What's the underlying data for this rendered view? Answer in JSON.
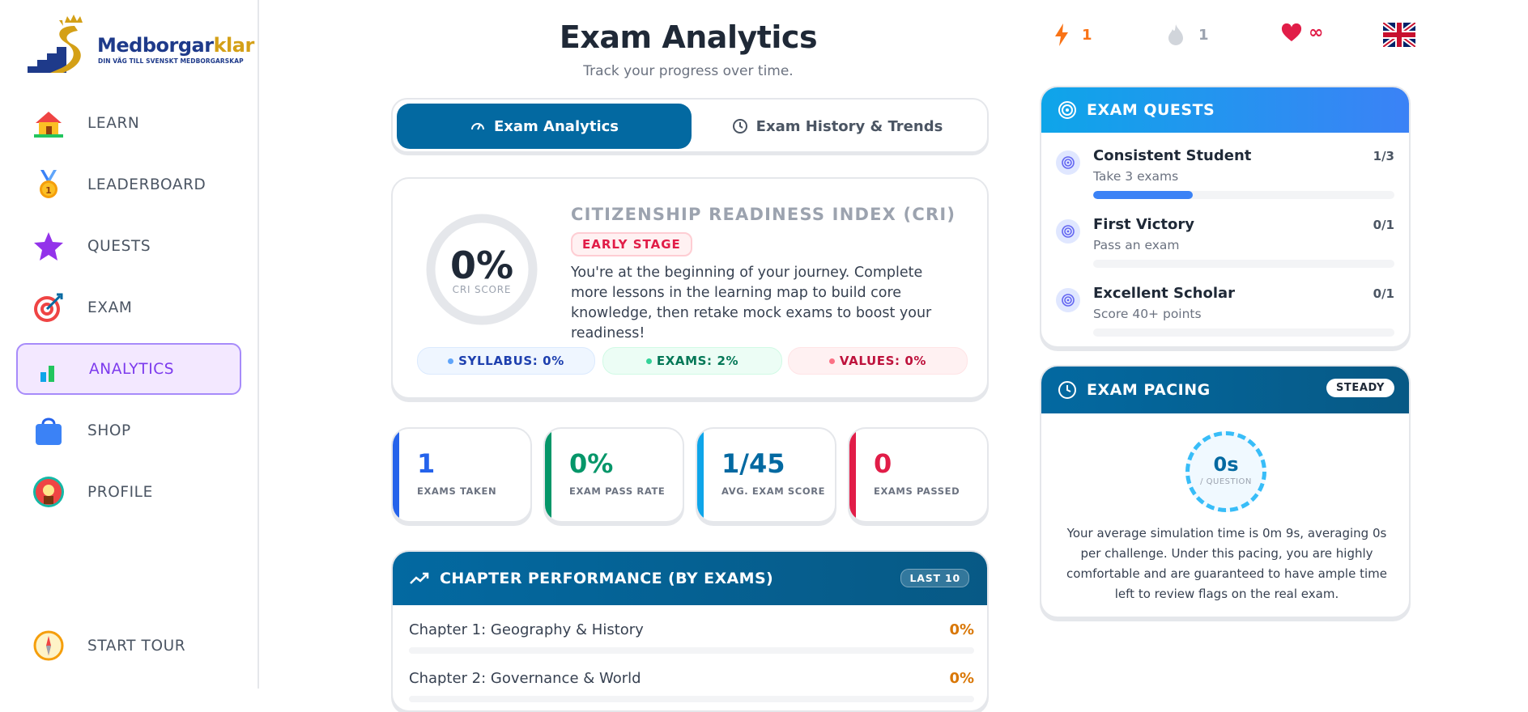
{
  "brand": {
    "name_part1": "Medborgar",
    "name_part2": "klar",
    "tagline": "DIN VÄG TILL SVENSKT MEDBORGARSKAP",
    "colors": {
      "navy": "#1e3a8a",
      "gold": "#d4a017"
    }
  },
  "sidebar": {
    "items": [
      {
        "label": "LEARN",
        "icon": "house-icon"
      },
      {
        "label": "LEADERBOARD",
        "icon": "medal-icon"
      },
      {
        "label": "QUESTS",
        "icon": "star-icon"
      },
      {
        "label": "EXAM",
        "icon": "target-icon"
      },
      {
        "label": "ANALYTICS",
        "icon": "bar-chart-icon",
        "active": true
      },
      {
        "label": "SHOP",
        "icon": "shopping-bag-icon"
      },
      {
        "label": "PROFILE",
        "icon": "avatar-icon"
      }
    ],
    "tour": {
      "label": "START TOUR",
      "icon": "compass-icon"
    }
  },
  "header": {
    "title": "Exam Analytics",
    "subtitle": "Track your progress over time."
  },
  "tabs": [
    {
      "label": "Exam Analytics",
      "icon": "gauge-icon",
      "active": true
    },
    {
      "label": "Exam History & Trends",
      "icon": "clock-icon",
      "active": false
    }
  ],
  "cri": {
    "percent": "0%",
    "score_label": "CRI SCORE",
    "progress": 0,
    "title": "CITIZENSHIP READINESS INDEX (CRI)",
    "stage": "EARLY STAGE",
    "description": "You're at the beginning of your journey. Complete more lessons in the learning map to build core knowledge, then retake mock exams to boost your readiness!",
    "pills": {
      "syllabus": "SYLLABUS: 0%",
      "exams": "EXAMS: 2%",
      "values": "VALUES: 0%"
    }
  },
  "stats": [
    {
      "value": "1",
      "caption": "EXAMS TAKEN",
      "color": "#2563eb"
    },
    {
      "value": "0%",
      "caption": "EXAM PASS RATE",
      "color": "#059669"
    },
    {
      "value": "1/45",
      "caption": "AVG. EXAM SCORE",
      "color": "#0284c7"
    },
    {
      "value": "0",
      "caption": "EXAMS PASSED",
      "color": "#e11d48"
    }
  ],
  "chapters": {
    "title": "CHAPTER PERFORMANCE (BY EXAMS)",
    "badge": "LAST 10",
    "rows": [
      {
        "name": "Chapter 1: Geography & History",
        "percent": "0%"
      },
      {
        "name": "Chapter 2: Governance & World",
        "percent": "0%"
      }
    ]
  },
  "top_stats": {
    "streak": "1",
    "gems": "1",
    "hearts": "∞",
    "language_flag": "uk-flag-icon"
  },
  "quests": {
    "title": "EXAM QUESTS",
    "items": [
      {
        "title": "Consistent Student",
        "count": "1/3",
        "desc": "Take 3 exams",
        "progress": 0.33
      },
      {
        "title": "First Victory",
        "count": "0/1",
        "desc": "Pass an exam",
        "progress": 0
      },
      {
        "title": "Excellent Scholar",
        "count": "0/1",
        "desc": "Score 40+ points",
        "progress": 0
      }
    ]
  },
  "pacing": {
    "title": "EXAM PACING",
    "badge": "STEADY",
    "value": "0s",
    "unit": "/ QUESTION",
    "description": "Your average simulation time is 0m 9s, averaging 0s per challenge. Under this pacing, you are highly comfortable and are guaranteed to have ample time left to review flags on the real exam."
  }
}
